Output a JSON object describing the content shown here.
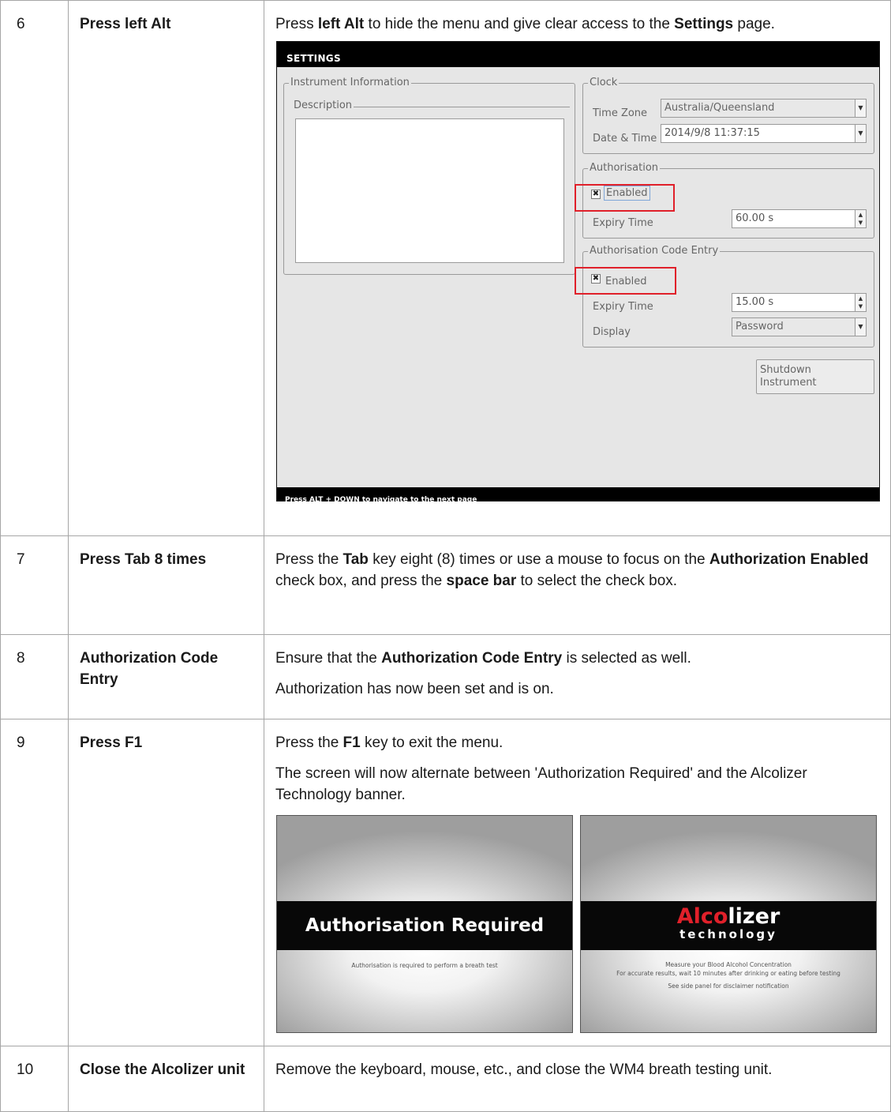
{
  "rows": [
    {
      "num": "6",
      "title": "Press left Alt",
      "desc": {
        "pre": "Press ",
        "b1": "left Alt",
        "mid": " to hide the menu and give clear access to the ",
        "b2": "Settings",
        "post": " page."
      }
    },
    {
      "num": "7",
      "title": "Press Tab 8 times",
      "desc": {
        "pre": "Press the ",
        "b1": "Tab",
        "mid1": " key eight (8) times or use a mouse to focus on the ",
        "b2": "Authorization Enabled",
        "mid2": " check box, and press the ",
        "b3": "space bar",
        "post": " to select the check box."
      }
    },
    {
      "num": "8",
      "title": "Authorization Code Entry",
      "desc": {
        "pre": "Ensure that the ",
        "b1": "Authorization Code Entry",
        "post": " is selected as well.",
        "p2": "Authorization has now been set and is on."
      }
    },
    {
      "num": "9",
      "title": "Press F1",
      "desc": {
        "pre": "Press the ",
        "b1": "F1",
        "post": " key to exit the menu.",
        "p2": "The screen will now alternate between 'Authorization Required' and the Alcolizer Technology banner."
      }
    },
    {
      "num": "10",
      "title": "Close the Alcolizer unit",
      "desc": {
        "text": "Remove the keyboard, mouse, etc., and close the WM4 breath testing unit."
      }
    }
  ],
  "settings_screen": {
    "header": "SETTINGS",
    "footer": "Press ALT + DOWN to navigate to the next page",
    "instrument_info": {
      "legend": "Instrument Information",
      "description_legend": "Description"
    },
    "clock": {
      "legend": "Clock",
      "time_zone_label": "Time Zone",
      "time_zone_value": "Australia/Queensland",
      "date_time_label": "Date & Time",
      "date_time_value": "2014/9/8 11:37:15"
    },
    "authorisation": {
      "legend": "Authorisation",
      "enabled_label": "Enabled",
      "enabled_checked": true,
      "expiry_label": "Expiry Time",
      "expiry_value": "60.00 s"
    },
    "code_entry": {
      "legend": "Authorisation Code Entry",
      "enabled_label": "Enabled",
      "enabled_checked": true,
      "expiry_label": "Expiry Time",
      "expiry_value": "15.00 s",
      "display_label": "Display",
      "display_value": "Password"
    },
    "shutdown_button": "Shutdown Instrument",
    "highlight_color": "#e0202a"
  },
  "banner_auth": {
    "title": "Authorisation Required",
    "subtitle": "Authorisation is required to perform a breath test"
  },
  "banner_alcolizer": {
    "logo_a": "A",
    "logo_lco": "lco",
    "logo_lizer": "lizer",
    "logo_sub": "technology",
    "line1": "Measure your Blood Alcohol Concentration",
    "line2": "For accurate results, wait 10 minutes after drinking or eating before testing",
    "line3": "See side panel for disclaimer notification",
    "brand_red": "#e0202a"
  }
}
